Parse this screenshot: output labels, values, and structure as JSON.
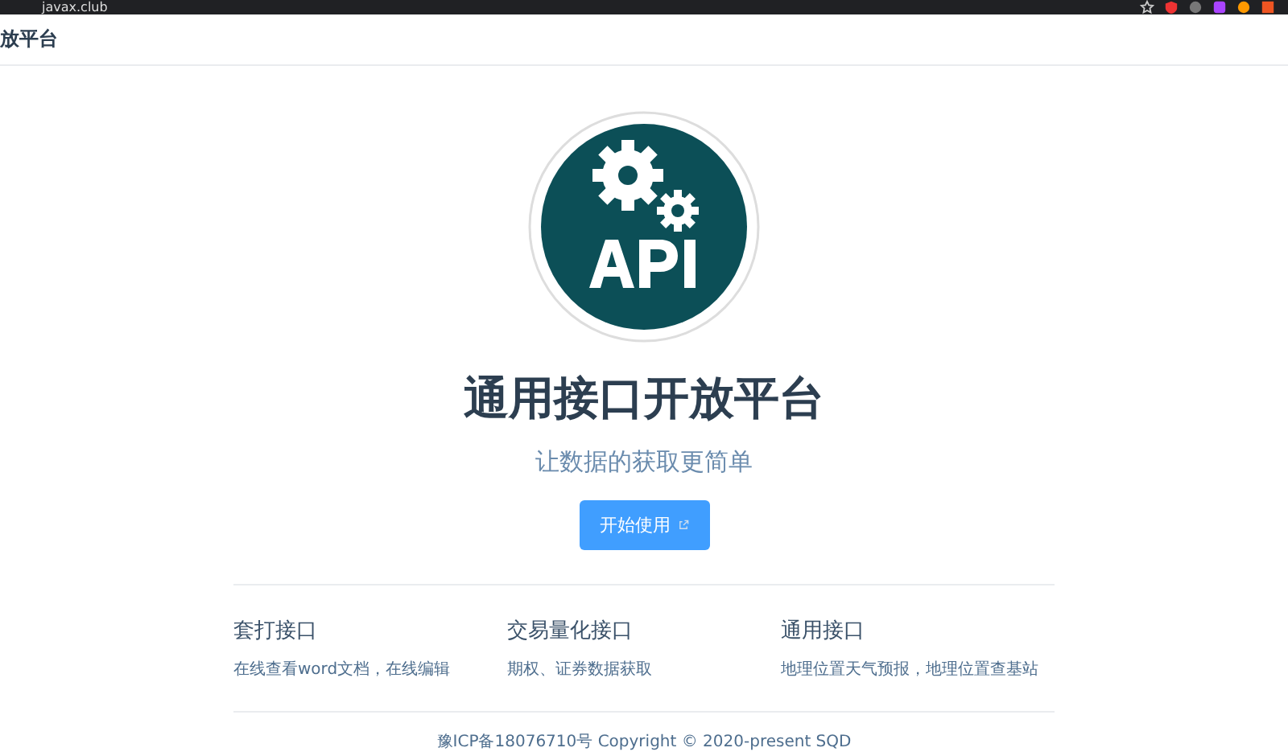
{
  "browser": {
    "url": "javax.club"
  },
  "header": {
    "title": "放平台"
  },
  "hero": {
    "title": "通用接口开放平台",
    "subtitle": "让数据的获取更简单",
    "button": "开始使用"
  },
  "features": [
    {
      "title": "套打接口",
      "description": "在线查看word文档，在线编辑"
    },
    {
      "title": "交易量化接口",
      "description": "期权、证券数据获取"
    },
    {
      "title": "通用接口",
      "description": "地理位置天气预报，地理位置查基站"
    }
  ],
  "footer": {
    "text": "豫ICP备18076710号 Copyright © 2020-present SQD"
  }
}
